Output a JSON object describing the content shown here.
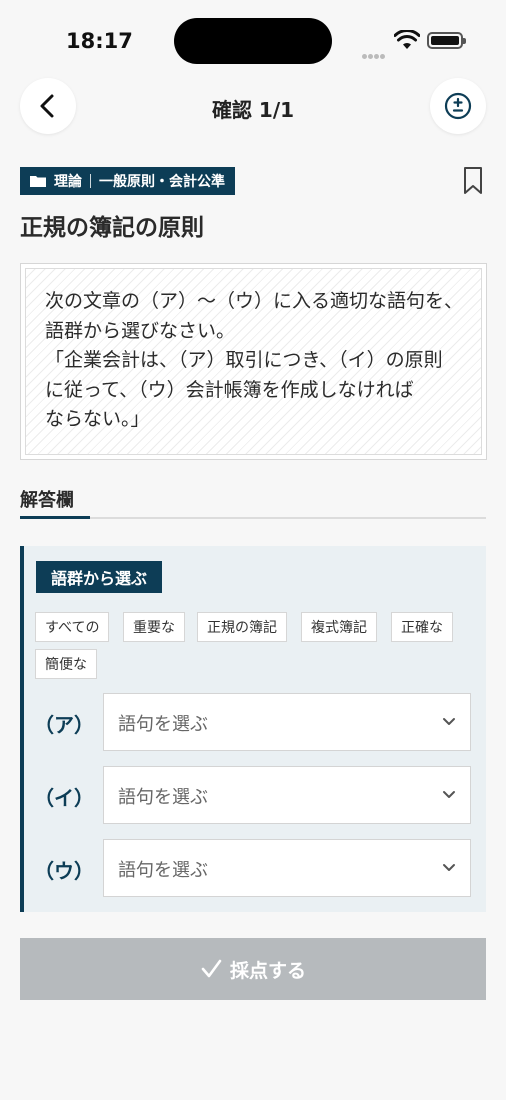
{
  "status_bar": {
    "time": "18:17"
  },
  "nav": {
    "title": "確認  1/1",
    "back_icon": "chevron-left-icon",
    "tools_icon": "plus-minus-icon"
  },
  "category": {
    "part1": "理論",
    "part2": "一般原則・会計公準",
    "icon": "folder-icon"
  },
  "question": {
    "title": "正規の簿記の原則",
    "lines": [
      "次の文章の（ア）～（ウ）に入る適切な語句を、",
      "語群から選びなさい。",
      "「企業会計は、（ア）取引につき、（イ）の原則",
      "に従って、（ウ）会計帳簿を作成しなければ",
      "ならない。」"
    ]
  },
  "answer": {
    "tab_label": "解答欄",
    "panel_label": "語群から選ぶ",
    "chips": [
      "すべての",
      "重要な",
      "正規の簿記",
      "複式簿記",
      "正確な",
      "簡便な"
    ],
    "rows": [
      {
        "label": "（ア）",
        "placeholder": "語句を選ぶ"
      },
      {
        "label": "（イ）",
        "placeholder": "語句を選ぶ"
      },
      {
        "label": "（ウ）",
        "placeholder": "語句を選ぶ"
      }
    ]
  },
  "submit": {
    "label": "採点する",
    "state": "disabled"
  },
  "colors": {
    "accent": "#0d3d56",
    "panel_bg": "#eaf0f3",
    "disabled_button": "#b6babd",
    "page_bg": "#f7f7f7"
  }
}
